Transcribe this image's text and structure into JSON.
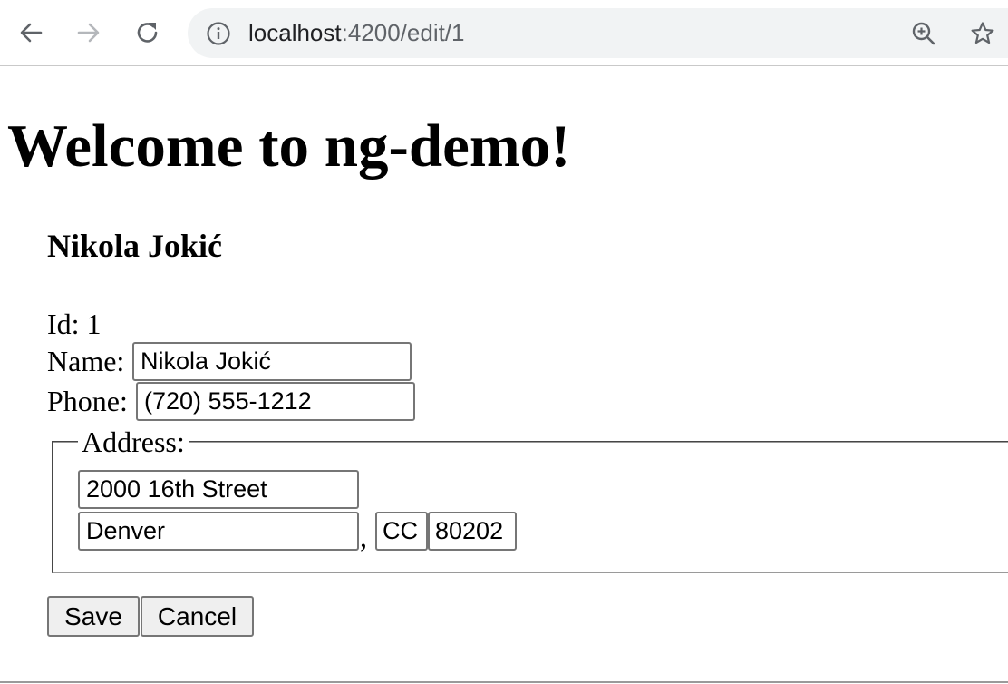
{
  "browser": {
    "url_host": "localhost",
    "url_path": ":4200/edit/1",
    "icons": {
      "back": "back-arrow-icon",
      "forward": "forward-arrow-icon",
      "reload": "reload-icon",
      "info": "info-icon",
      "zoom": "zoom-in-icon",
      "bookmark": "star-icon"
    }
  },
  "page": {
    "title": "Welcome to ng-demo!"
  },
  "hero": {
    "name_heading": "Nikola Jokić",
    "id_label": "Id:",
    "id_value": "1",
    "name_label": "Name:",
    "name_value": "Nikola Jokić",
    "phone_label": "Phone:",
    "phone_value": "(720) 555-1212"
  },
  "address": {
    "legend": "Address:",
    "street": "2000 16th Street",
    "city": "Denver",
    "separator": ",",
    "state": "CC",
    "zip": "80202"
  },
  "actions": {
    "save_label": "Save",
    "cancel_label": "Cancel"
  }
}
